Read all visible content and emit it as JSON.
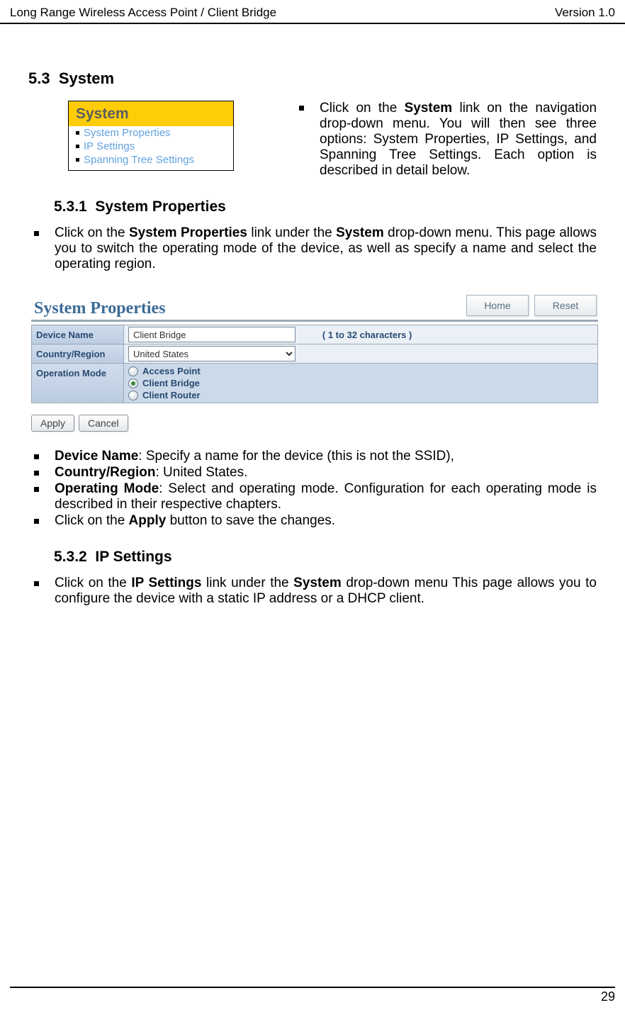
{
  "header": {
    "left": "Long Range Wireless Access Point / Client Bridge",
    "right": "Version 1.0"
  },
  "footer": {
    "page": "29"
  },
  "sections": {
    "s53": {
      "num": "5.3",
      "title": "System"
    },
    "s531": {
      "num": "5.3.1",
      "title": "System Properties"
    },
    "s532": {
      "num": "5.3.2",
      "title": "IP Settings"
    }
  },
  "nav": {
    "title": "System",
    "items": [
      "System Properties",
      "IP Settings",
      "Spanning Tree Settings"
    ]
  },
  "intro_text": {
    "pre": "Click on the ",
    "b1": "System",
    "post": " link on the navigation drop-down menu. You will then see three options: System Properties, IP Settings, and Spanning Tree Settings. Each option is described in detail below."
  },
  "syspropstext": {
    "pre": "Click on the ",
    "b1": "System Properties",
    "mid": " link under the ",
    "b2": "System",
    "post": " drop-down menu. This page allows you to switch the operating mode of the device, as well as specify a name and select the operating region."
  },
  "ui": {
    "title": "System Properties",
    "home_btn": "Home",
    "reset_btn": "Reset",
    "device_name_label": "Device Name",
    "device_name_value": "Client Bridge",
    "device_name_hint": "( 1 to 32 characters )",
    "country_label": "Country/Region",
    "country_value": "United States",
    "opmode_label": "Operation Mode",
    "opmode_options": [
      "Access Point",
      "Client Bridge",
      "Client Router"
    ],
    "opmode_selected": 1,
    "apply_btn": "Apply",
    "cancel_btn": "Cancel"
  },
  "desc": {
    "dn_b": "Device Name",
    "dn": ": Specify a name for the device (this is not the SSID),",
    "cr_b": "Country/Region",
    "cr": ": United States.",
    "om_b": "Operating Mode",
    "om": ": Select and operating mode. Configuration for each operating mode is described in their respective chapters.",
    "apply_pre": "Click on the ",
    "apply_b": "Apply",
    "apply_post": " button to save the changes."
  },
  "ipsettings": {
    "pre": "Click on the ",
    "b1": "IP Settings",
    "mid": " link under the ",
    "b2": "System",
    "post": " drop-down menu This page allows you to configure the device with a static IP address or a DHCP client."
  }
}
